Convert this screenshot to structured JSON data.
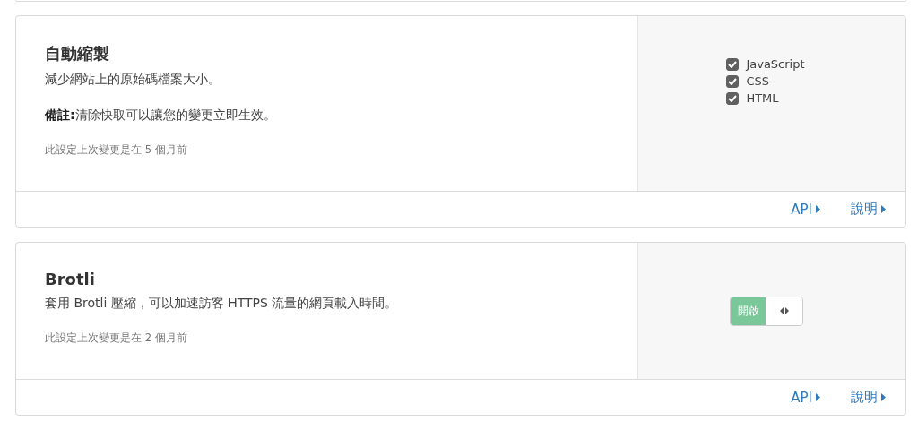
{
  "cards": [
    {
      "title": "自動縮製",
      "paragraphs": [
        "減少網站上的原始碼檔案大小。",
        "**備註:**清除快取可以讓您的變更立即生效。"
      ],
      "modified": "此設定上次變更是在 5 個月前",
      "control": {
        "kind": "checkboxes",
        "options": [
          {
            "label": "JavaScript",
            "checked": true
          },
          {
            "label": "CSS",
            "checked": true
          },
          {
            "label": "HTML",
            "checked": true
          }
        ]
      },
      "links": [
        "API",
        "說明"
      ]
    },
    {
      "title": "Brotli",
      "paragraphs": [
        "套用 Brotli 壓縮，可以加速訪客 HTTPS 流量的網頁載入時間。"
      ],
      "modified": "此設定上次變更是在 2 個月前",
      "control": {
        "kind": "toggle",
        "label": "開啟",
        "on": true
      },
      "links": [
        "API",
        "說明"
      ]
    }
  ]
}
